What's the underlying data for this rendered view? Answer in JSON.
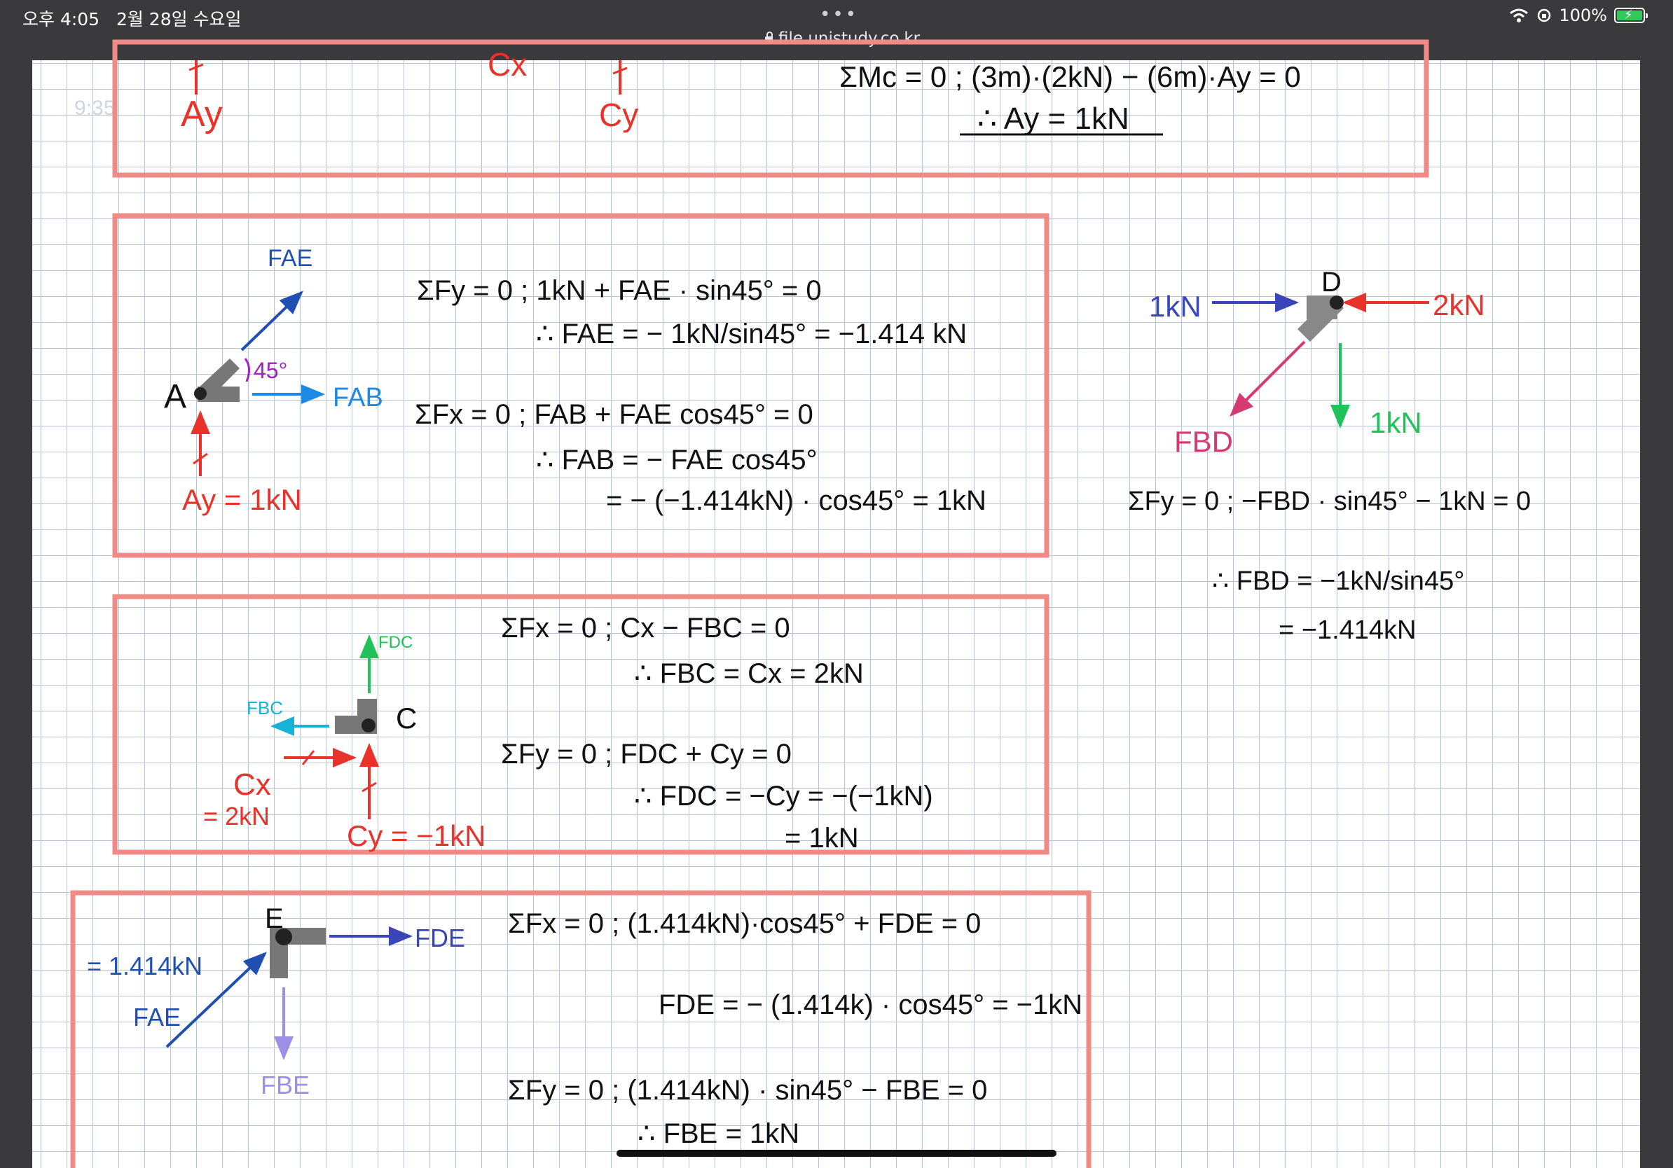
{
  "status": {
    "time": "오후 4:05",
    "date": "2월 28일 수요일",
    "battery": "100%",
    "url": "file.unistudy.co.kr",
    "dots": "•••"
  },
  "colors": {
    "box": "#f08a86",
    "red": "#e8322a",
    "blue": "#1f4fb0",
    "lightblue": "#1e88e5",
    "green": "#22c25a",
    "cyan": "#17b3d6",
    "pink": "#d63a73",
    "purple": "#9b8fe6",
    "violet": "#a020c0",
    "indigo": "#3a46b8"
  },
  "top": {
    "ay": "Ay",
    "cx": "Cx",
    "cy": "Cy",
    "eq1": "ΣMc = 0  ;  (3m)·(2kN) − (6m)·Ay = 0",
    "eq2": "∴ Ay = 1kN"
  },
  "jointA": {
    "fae": "FAE",
    "angle": "45°",
    "a": "A",
    "fab": "FAB",
    "ay": "Ay = 1kN",
    "eq1": "ΣFy = 0  ;  1kN + FAE · sin45° = 0",
    "eq2": "∴ FAE = − 1kN/sin45°   =  −1.414 kN",
    "eq3": "ΣFx = 0   ;  FAB + FAE cos45° = 0",
    "eq4": "∴ FAB = − FAE cos45°",
    "eq5": "= − (−1.414kN) · cos45° = 1kN"
  },
  "jointC": {
    "fdc": "FDC",
    "fbc": "FBC",
    "c": "C",
    "cx": "Cx",
    "cxv": "= 2kN",
    "cy": "Cy = −1kN",
    "eq1": "ΣFx = 0 ;    Cx − FBC = 0",
    "eq2": "∴ FBC = Cx = 2kN",
    "eq3": "ΣFy = 0  ;   FDC + Cy = 0",
    "eq4": "∴ FDC = −Cy  = −(−1kN)",
    "eq5": "= 1kN"
  },
  "jointD": {
    "l1": "1kN",
    "d": "D",
    "l2": "2kN",
    "fbd": "FBD",
    "l3": "1kN",
    "eq1": "ΣFy = 0 ;   −FBD · sin45° − 1kN = 0",
    "eq2": "∴ FBD = −1kN/sin45°",
    "eq3": "= −1.414kN"
  },
  "jointE": {
    "e": "E",
    "fde": "FDE",
    "val": "= 1.414kN",
    "fae": "FAE",
    "fbe": "FBE",
    "eq1": "ΣFx = 0 ;  (1.414kN)·cos45°  + FDE = 0",
    "eq2": "FDE = − (1.414k) · cos45°  = −1kN",
    "eq3": "ΣFy = 0  ;   (1.414kN) · sin45°  − FBE = 0",
    "eq4": "∴ FBE = 1kN"
  }
}
